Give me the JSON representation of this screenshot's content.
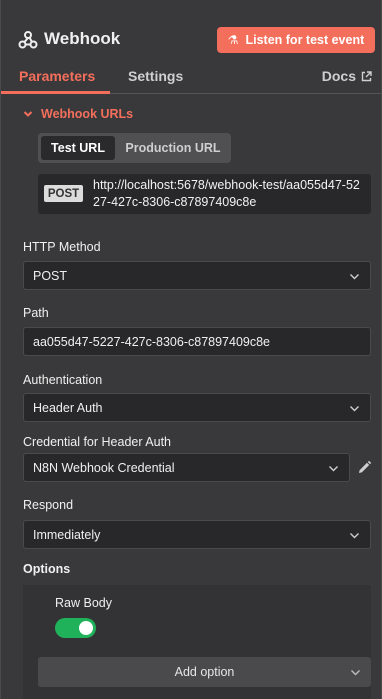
{
  "header": {
    "icon": "webhook-icon",
    "title": "Webhook",
    "listen_button": "Listen for test event",
    "listen_icon": "flask-icon",
    "accent": "#f36f5c"
  },
  "tabs": {
    "parameters": "Parameters",
    "settings": "Settings",
    "docs": "Docs",
    "docs_icon": "external-link-icon",
    "active": "Parameters"
  },
  "webhook_urls": {
    "section_label": "Webhook URLs",
    "test_tab": "Test URL",
    "production_tab": "Production URL",
    "active_tab": "Test URL",
    "method": "POST",
    "url": "http://localhost:5678/webhook-test/aa055d47-5227-427c-8306-c87897409c8e"
  },
  "fields": {
    "http_method": {
      "label": "HTTP Method",
      "value": "POST"
    },
    "path": {
      "label": "Path",
      "value": "aa055d47-5227-427c-8306-c87897409c8e"
    },
    "authentication": {
      "label": "Authentication",
      "value": "Header Auth"
    },
    "credential": {
      "label": "Credential for Header Auth",
      "value": "N8N Webhook Credential"
    },
    "respond": {
      "label": "Respond",
      "value": "Immediately"
    }
  },
  "options": {
    "label": "Options",
    "raw_body": {
      "label": "Raw Body",
      "enabled": true,
      "color": "#1fb25a"
    },
    "add_option": "Add option"
  }
}
